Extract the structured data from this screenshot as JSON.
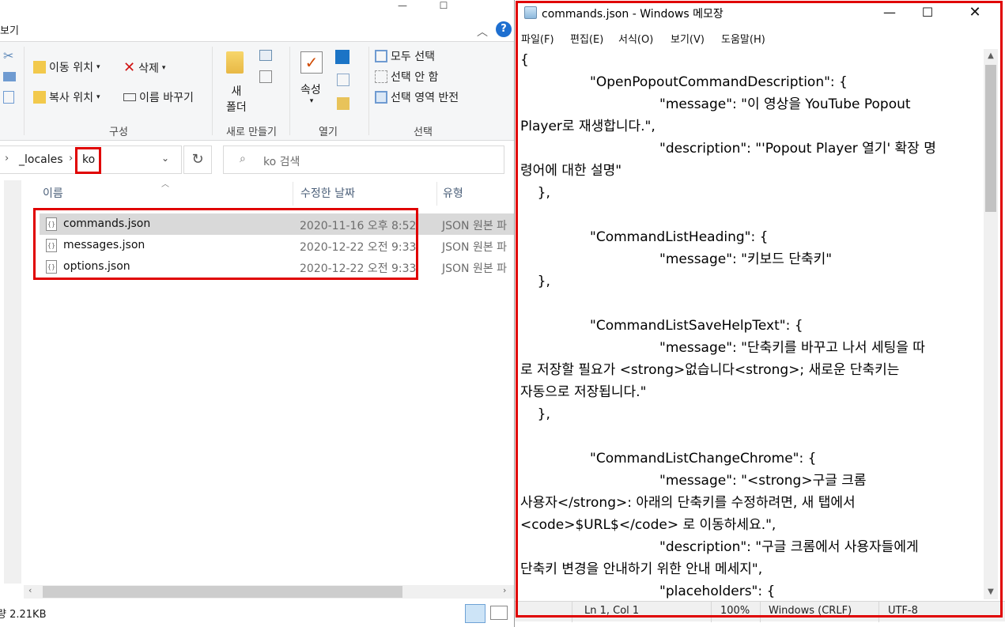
{
  "explorer": {
    "view_tab": "보기",
    "ribbon": {
      "move_to": "이동 위치",
      "copy_to": "복사 위치",
      "delete": "삭제",
      "rename": "이름 바꾸기",
      "group_organize": "구성",
      "new_folder_line1": "새",
      "new_folder_line2": "폴더",
      "group_new": "새로 만들기",
      "properties": "속성",
      "group_open": "열기",
      "select_all": "모두 선택",
      "select_none": "선택 안 함",
      "invert_selection": "선택 영역 반전",
      "group_select": "선택"
    },
    "breadcrumb": {
      "sep": "›",
      "parent": "_locales",
      "current": "ko"
    },
    "search_placeholder": "ko 검색",
    "columns": {
      "name": "이름",
      "modified": "수정한 날짜",
      "type": "유형"
    },
    "files": [
      {
        "name": "commands.json",
        "modified": "2020-11-16 오후 8:52",
        "type": "JSON 원본 파"
      },
      {
        "name": "messages.json",
        "modified": "2020-12-22 오전 9:33",
        "type": "JSON 원본 파"
      },
      {
        "name": "options.json",
        "modified": "2020-12-22 오전 9:33",
        "type": "JSON 원본 파"
      }
    ],
    "status_size": "량 2.21KB"
  },
  "notepad": {
    "title": "commands.json - Windows 메모장",
    "menu": {
      "file": "파일(F)",
      "edit": "편집(E)",
      "format": "서식(O)",
      "view": "보기(V)",
      "help": "도움말(H)"
    },
    "lines": [
      "{",
      "\t\"OpenPopoutCommandDescription\": {",
      "\t\t\"message\": \"이 영상을 YouTube Popout",
      "Player로 재생합니다.\",",
      "\t\t\"description\": \"'Popout Player 열기' 확장 명",
      "령어에 대한 설명\"",
      "    },",
      "",
      "\t\"CommandListHeading\": {",
      "\t\t\"message\": \"키보드 단축키\"",
      "    },",
      "",
      "\t\"CommandListSaveHelpText\": {",
      "\t\t\"message\": \"단축키를 바꾸고 나서 세팅을 따",
      "로 저장할 필요가 <strong>없습니다<strong>; 새로운 단축키는",
      "자동으로 저장됩니다.\"",
      "    },",
      "",
      "\t\"CommandListChangeChrome\": {",
      "\t\t\"message\": \"<strong>구글 크롬",
      "사용자</strong>: 아래의 단축키를 수정하려면, 새 탭에서",
      "<code>$URL$</code> 로 이동하세요.\",",
      "\t\t\"description\": \"구글 크롬에서 사용자들에게",
      "단축키 변경을 안내하기 위한 안내 메세지\",",
      "\t\t\"placeholders\": {"
    ],
    "status": {
      "position": "Ln 1, Col 1",
      "zoom": "100%",
      "eol": "Windows (CRLF)",
      "encoding": "UTF-8"
    }
  }
}
